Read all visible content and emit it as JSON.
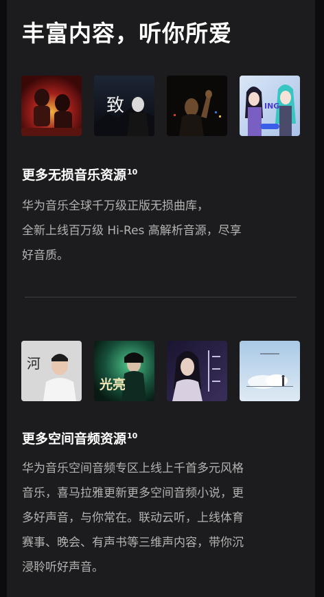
{
  "header": {
    "title": "丰富内容，听你所爱"
  },
  "lossless": {
    "title": "更多无损音乐资源",
    "footnote": "10",
    "lines": [
      "华为音乐全球千万级正版无损曲库，",
      "全新上线百万级 Hi-Res 高解析音源，尽享",
      "好音质。"
    ],
    "covers": [
      {
        "icon": "album-cover-red-band"
      },
      {
        "icon": "album-cover-dark-calligraphy",
        "text": "致"
      },
      {
        "icon": "album-cover-man-waving"
      },
      {
        "icon": "album-cover-anime-idol",
        "text": "ING"
      }
    ]
  },
  "spatial": {
    "title": "更多空间音频资源",
    "footnote": "10",
    "lines": [
      "华为音乐空间音频专区上线上千首多元风格",
      "音乐，喜马拉雅更新更多空间音频小说，更",
      "多好声音，与你常在。联动云听，上线体育",
      "赛事、晚会、有声书等三维声内容，带你沉",
      "浸聆听好声音。"
    ],
    "covers": [
      {
        "icon": "album-cover-singer-white-shirt",
        "text": "河"
      },
      {
        "icon": "album-cover-green-light",
        "text": "光亮"
      },
      {
        "icon": "album-cover-woman-portrait"
      },
      {
        "icon": "album-cover-sky-clouds"
      }
    ]
  },
  "colors": {
    "page_bg": "#0c0c0e",
    "panel_bg": "#1c1c1e",
    "body_text": "#b3b3b3",
    "divider": "#3e3e42"
  }
}
